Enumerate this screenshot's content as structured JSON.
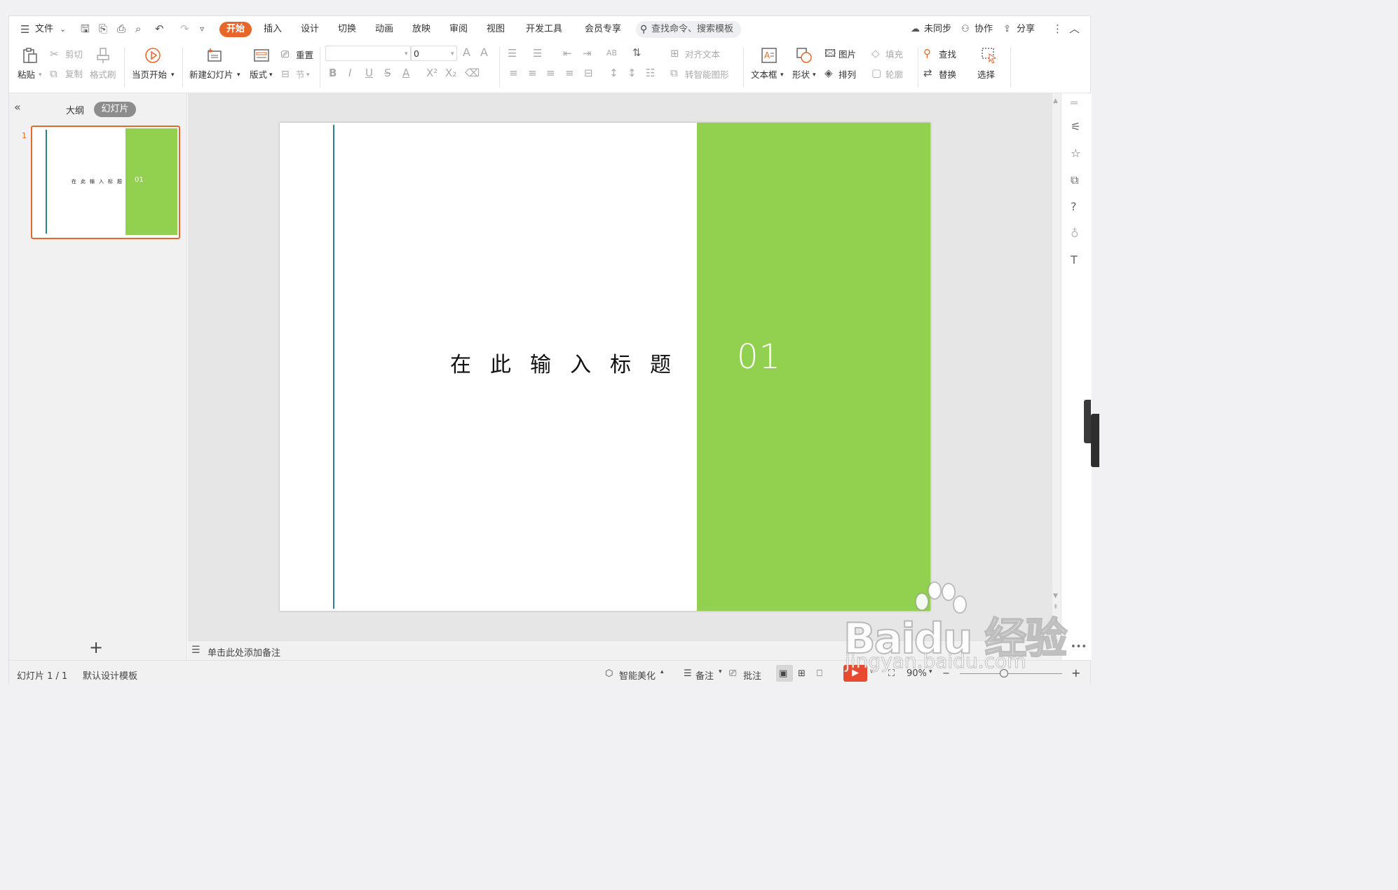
{
  "menu": {
    "file_label": "文件",
    "tabs": [
      "开始",
      "插入",
      "设计",
      "切换",
      "动画",
      "放映",
      "审阅",
      "视图",
      "开发工具",
      "会员专享"
    ],
    "active_tab": "开始",
    "search_placeholder": "查找命令、搜索模板",
    "sync_label": "未同步",
    "collab_label": "协作",
    "share_label": "分享"
  },
  "ribbon": {
    "paste": "粘贴",
    "cut": "剪切",
    "copy": "复制",
    "format_painter": "格式刷",
    "play_from_current": "当页开始",
    "new_slide": "新建幻灯片",
    "layout": "版式",
    "reset": "重置",
    "section": "节",
    "font_size_value": "0",
    "align_text": "对齐文本",
    "smart_art": "转智能图形",
    "textbox": "文本框",
    "shape": "形状",
    "picture": "图片",
    "arrange": "排列",
    "fill": "填充",
    "outline": "轮廓",
    "find": "查找",
    "replace": "替换",
    "select": "选择"
  },
  "panel": {
    "outline_tab": "大纲",
    "slides_tab": "幻灯片",
    "slide_number": "1",
    "thumb_title": "在此输入标题",
    "thumb_num": "01"
  },
  "slide": {
    "title": "在此输入标题",
    "number": "01",
    "colors": {
      "accent_green": "#92d050",
      "line_teal": "#2b7f8e"
    }
  },
  "notes": {
    "placeholder": "单击此处添加备注"
  },
  "status": {
    "slide_counter": "幻灯片 1 / 1",
    "template": "默认设计模板",
    "beautify": "智能美化",
    "notes": "备注",
    "comments": "批注",
    "zoom": "90%"
  },
  "watermark": {
    "brand": "Bai",
    "brand2": "du",
    "suffix": "经验",
    "url": "jingyan.baidu.com"
  }
}
